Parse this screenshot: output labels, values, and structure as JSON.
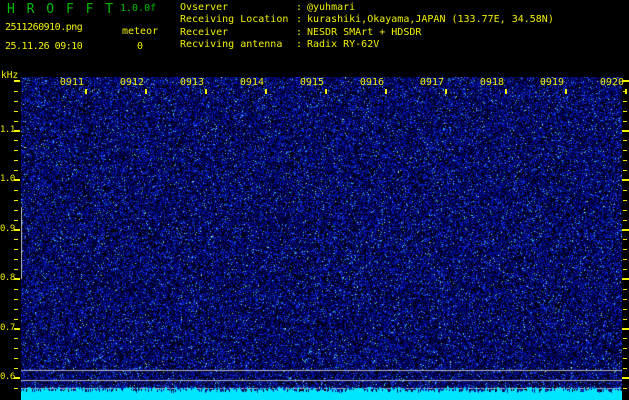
{
  "app": {
    "title": "H R O F F T",
    "version": "1.0.0f",
    "filename": "2511260910.png",
    "date_time": "25.11.26 09:10",
    "counter_label": "meteor",
    "counter_value": "0"
  },
  "info": {
    "rows": [
      {
        "label": "Ovserver",
        "separator": ":",
        "value": "@yuhmari"
      },
      {
        "label": "Receiving Location",
        "separator": ":",
        "value": "kurashiki,Okayama,JAPAN (133.77E, 34.58N)"
      },
      {
        "label": "Receiver",
        "separator": ":",
        "value": "NESDR SMArt + HDSDR"
      },
      {
        "label": "Recviving antenna",
        "separator": ":",
        "value": "Radix RY-62V"
      }
    ]
  },
  "spectrogram": {
    "y_axis_unit": "kHz",
    "freq_tick_labels": [
      "1.1",
      "1.0",
      "0.9",
      "0.8",
      "0.7",
      "0.6"
    ],
    "time_tick_labels": [
      "0911",
      "0912",
      "0913",
      "0914",
      "0915",
      "0916",
      "0917",
      "0918",
      "0919",
      "0920"
    ]
  },
  "colors": {
    "background": "#000000",
    "title_green": "#00bc00",
    "text_yellow": "#f0f000",
    "noise_dark_blue": "#000070",
    "noise_blue": "#0000c0",
    "noise_bright_blue": "#2050f0",
    "noise_cyan": "#30c8f0",
    "signal_line_gray": "#c4c4c4",
    "waveform_cyan": "#00e6ff"
  }
}
